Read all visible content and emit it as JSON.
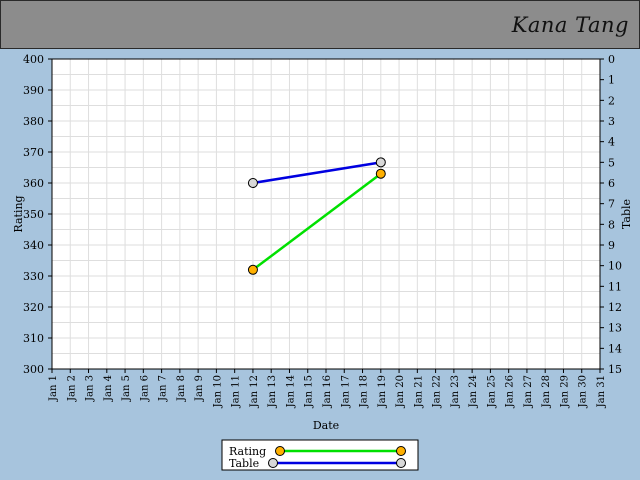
{
  "header": {
    "name": "Kana Tang"
  },
  "chart_data": {
    "type": "line",
    "xlabel": "Date",
    "ylabel": "Rating",
    "y2label": "Table",
    "x_ticks": [
      "Jan 1",
      "Jan 2",
      "Jan 3",
      "Jan 4",
      "Jan 5",
      "Jan 6",
      "Jan 7",
      "Jan 8",
      "Jan 9",
      "Jan 10",
      "Jan 11",
      "Jan 12",
      "Jan 13",
      "Jan 14",
      "Jan 15",
      "Jan 16",
      "Jan 17",
      "Jan 18",
      "Jan 19",
      "Jan 20",
      "Jan 21",
      "Jan 22",
      "Jan 23",
      "Jan 24",
      "Jan 25",
      "Jan 26",
      "Jan 27",
      "Jan 28",
      "Jan 29",
      "Jan 30",
      "Jan 31"
    ],
    "y_ticks": [
      300,
      310,
      320,
      330,
      340,
      350,
      360,
      370,
      380,
      390,
      400
    ],
    "y2_ticks": [
      0,
      1,
      2,
      3,
      4,
      5,
      6,
      7,
      8,
      9,
      10,
      11,
      12,
      13,
      14,
      15
    ],
    "ylim": [
      300,
      400
    ],
    "y2lim": [
      15,
      0
    ],
    "grid": true,
    "legend_position": "bottom-center",
    "series": [
      {
        "name": "Rating",
        "axis": "left",
        "color": "#00e000",
        "marker_color": "#ffb000",
        "points": [
          {
            "x": "Jan 12",
            "y": 332
          },
          {
            "x": "Jan 19",
            "y": 363
          }
        ]
      },
      {
        "name": "Table",
        "axis": "right",
        "color": "#0000e0",
        "marker_color": "#d8d8d8",
        "points": [
          {
            "x": "Jan 12",
            "y": 6
          },
          {
            "x": "Jan 19",
            "y": 5
          }
        ]
      }
    ]
  }
}
